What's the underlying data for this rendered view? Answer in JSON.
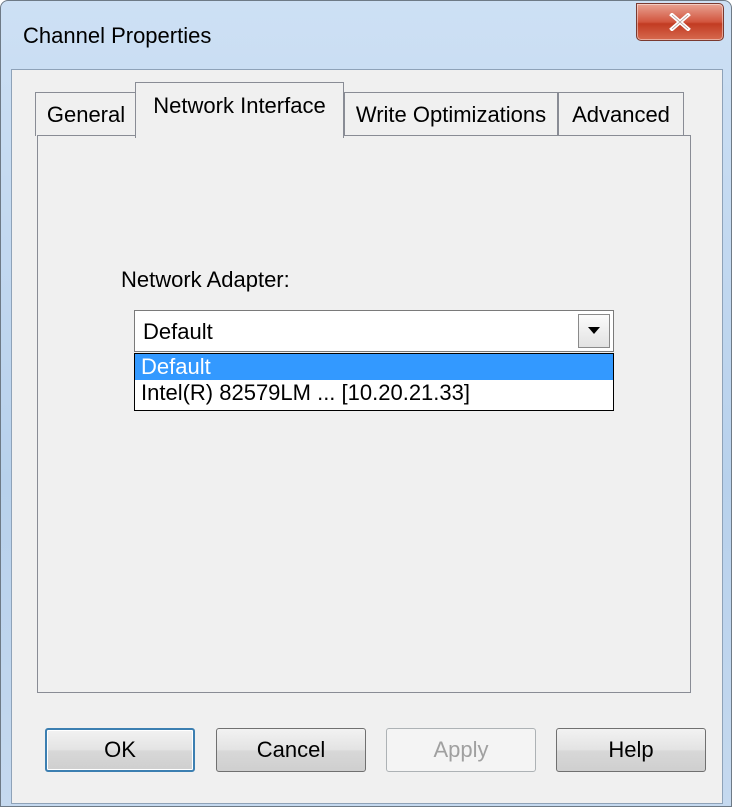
{
  "window": {
    "title": "Channel Properties",
    "close_icon": "close-icon"
  },
  "tabs": [
    {
      "label": "General",
      "selected": false
    },
    {
      "label": "Network Interface",
      "selected": true
    },
    {
      "label": "Write Optimizations",
      "selected": false
    },
    {
      "label": "Advanced",
      "selected": false
    }
  ],
  "network_interface": {
    "adapter_label": "Network Adapter:",
    "adapter_value": "Default",
    "dropdown_icon": "chevron-down-icon",
    "options": [
      {
        "label": "Default",
        "highlighted": true
      },
      {
        "label": "Intel(R) 82579LM ... [10.20.21.33]",
        "highlighted": false
      }
    ]
  },
  "buttons": {
    "ok": "OK",
    "cancel": "Cancel",
    "apply": "Apply",
    "help": "Help"
  },
  "colors": {
    "selection": "#3399ff",
    "close_button": "#c23b22"
  }
}
